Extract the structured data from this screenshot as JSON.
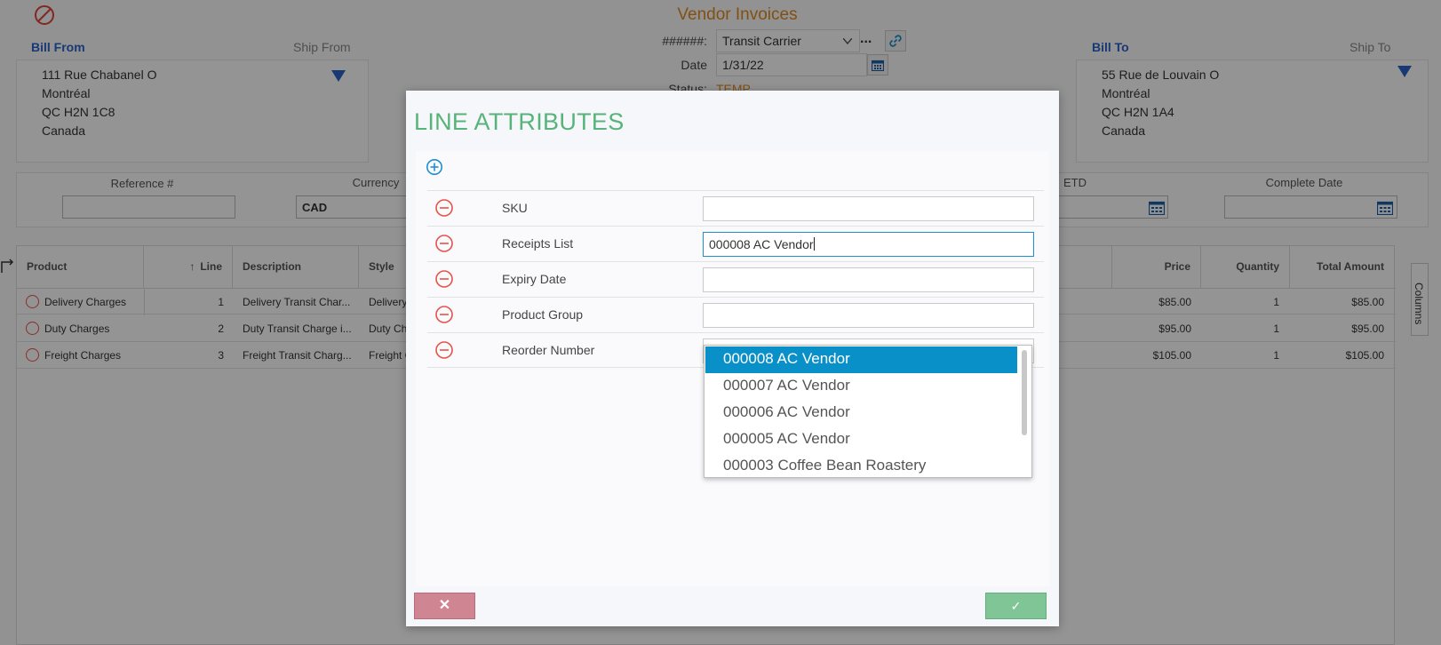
{
  "page": {
    "title": "Vendor Invoices",
    "bill_from": {
      "title": "Bill From",
      "ship_title": "Ship From",
      "lines": [
        "111 Rue Chabanel O",
        "Montréal",
        "QC H2N 1C8",
        "Canada"
      ]
    },
    "bill_to": {
      "title": "Bill To",
      "ship_title": "Ship To",
      "lines": [
        "55 Rue de Louvain O",
        "Montréal",
        "QC H2N 1A4",
        "Canada"
      ]
    },
    "header": {
      "number_label": "######:",
      "carrier_value": "Transit Carrier",
      "more_label": "...",
      "date_label": "Date",
      "date_value": "1/31/22",
      "status_label": "Status:",
      "status_value": "TEMP"
    },
    "fields": {
      "reference_label": "Reference #",
      "reference_value": "",
      "currency_label": "Currency",
      "currency_value": "CAD",
      "etd_label": "ETD",
      "complete_date_label": "Complete Date"
    },
    "grid": {
      "columns": {
        "product": "Product",
        "line": "Line",
        "description": "Description",
        "style": "Style",
        "price": "Price",
        "quantity": "Quantity",
        "total": "Total Amount"
      },
      "rows": [
        {
          "product": "Delivery Charges",
          "line": "1",
          "description": "Delivery Transit Char...",
          "style": "Delivery",
          "price": "$85.00",
          "quantity": "1",
          "total": "$85.00"
        },
        {
          "product": "Duty Charges",
          "line": "2",
          "description": "Duty Transit Charge i...",
          "style": "Duty Ch",
          "price": "$95.00",
          "quantity": "1",
          "total": "$95.00"
        },
        {
          "product": "Freight Charges",
          "line": "3",
          "description": "Freight Transit Charg...",
          "style": "Freight C",
          "price": "$105.00",
          "quantity": "1",
          "total": "$105.00"
        }
      ],
      "columns_tab_label": "Columns"
    }
  },
  "modal": {
    "title": "LINE ATTRIBUTES",
    "attributes": [
      {
        "label": "SKU",
        "value": ""
      },
      {
        "label": "Receipts List",
        "value": "000008 AC Vendor"
      },
      {
        "label": "Expiry Date",
        "value": ""
      },
      {
        "label": "Product Group",
        "value": ""
      },
      {
        "label": "Reorder Number",
        "value": ""
      }
    ],
    "dropdown": {
      "options": [
        "000008 AC Vendor",
        "000007 AC Vendor",
        "000006 AC Vendor",
        "000005 AC Vendor",
        "000003 Coffee Bean Roastery"
      ],
      "selected_index": 0
    },
    "cancel_label": "✕",
    "ok_label": "✓"
  },
  "colors": {
    "accent_green": "#57b37a",
    "title_orange": "#e08a1e",
    "link_blue": "#2a63c9",
    "selected_blue": "#0a90c8",
    "remove_red": "#e5544a",
    "cancel_pink": "#d08593",
    "ok_green": "#7fc596"
  }
}
